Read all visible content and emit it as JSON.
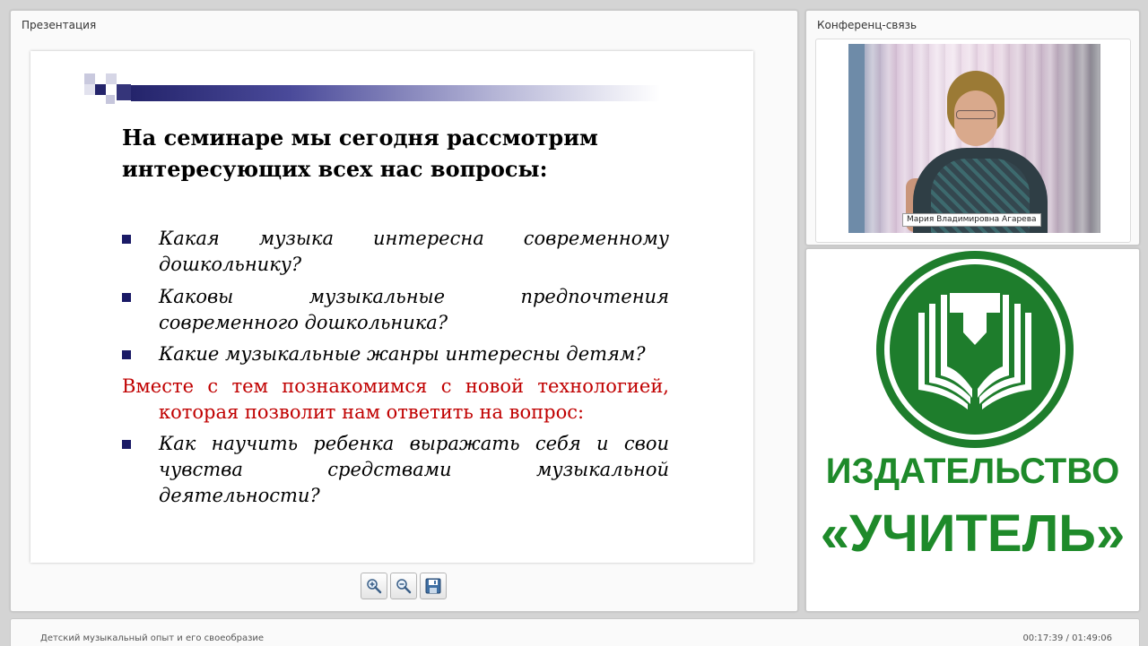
{
  "presentation": {
    "panel_title": "Презентация",
    "slide": {
      "heading": "На семинаре мы сегодня рассмотрим интересующих всех нас вопросы:",
      "questions": [
        "Какая музыка интересна современному дошкольнику?",
        "Каковы музыкальные предпочтения современного дошкольника?",
        "Какие музыкальные жанры интересны детям?"
      ],
      "highlight_line1": "Вместе с тем познакомимся с новой технологией,",
      "highlight_line2": "которая позволит нам ответить на вопрос:",
      "final_question": "Как научить ребенка выражать себя и свои чувства средствами музыкальной деятельности?",
      "colors": {
        "heading": "#000000",
        "highlight": "#c00000",
        "bullet": "#1a1a66"
      }
    },
    "toolbar": {
      "zoom_in_icon": "zoom-in-icon",
      "zoom_out_icon": "zoom-out-icon",
      "save_icon": "floppy-disk-icon"
    }
  },
  "conference": {
    "panel_title": "Конференц-связь",
    "participant_name": "Мария Владимировна Агарева"
  },
  "publisher": {
    "line1": "ИЗДАТЕЛЬСТВО",
    "line2": "«УЧИТЕЛЬ»",
    "color": "#1e7d2c"
  },
  "footer": {
    "title": "Детский музыкальный опыт и его своеобразие",
    "time": "00:17:39 / 01:49:06"
  }
}
